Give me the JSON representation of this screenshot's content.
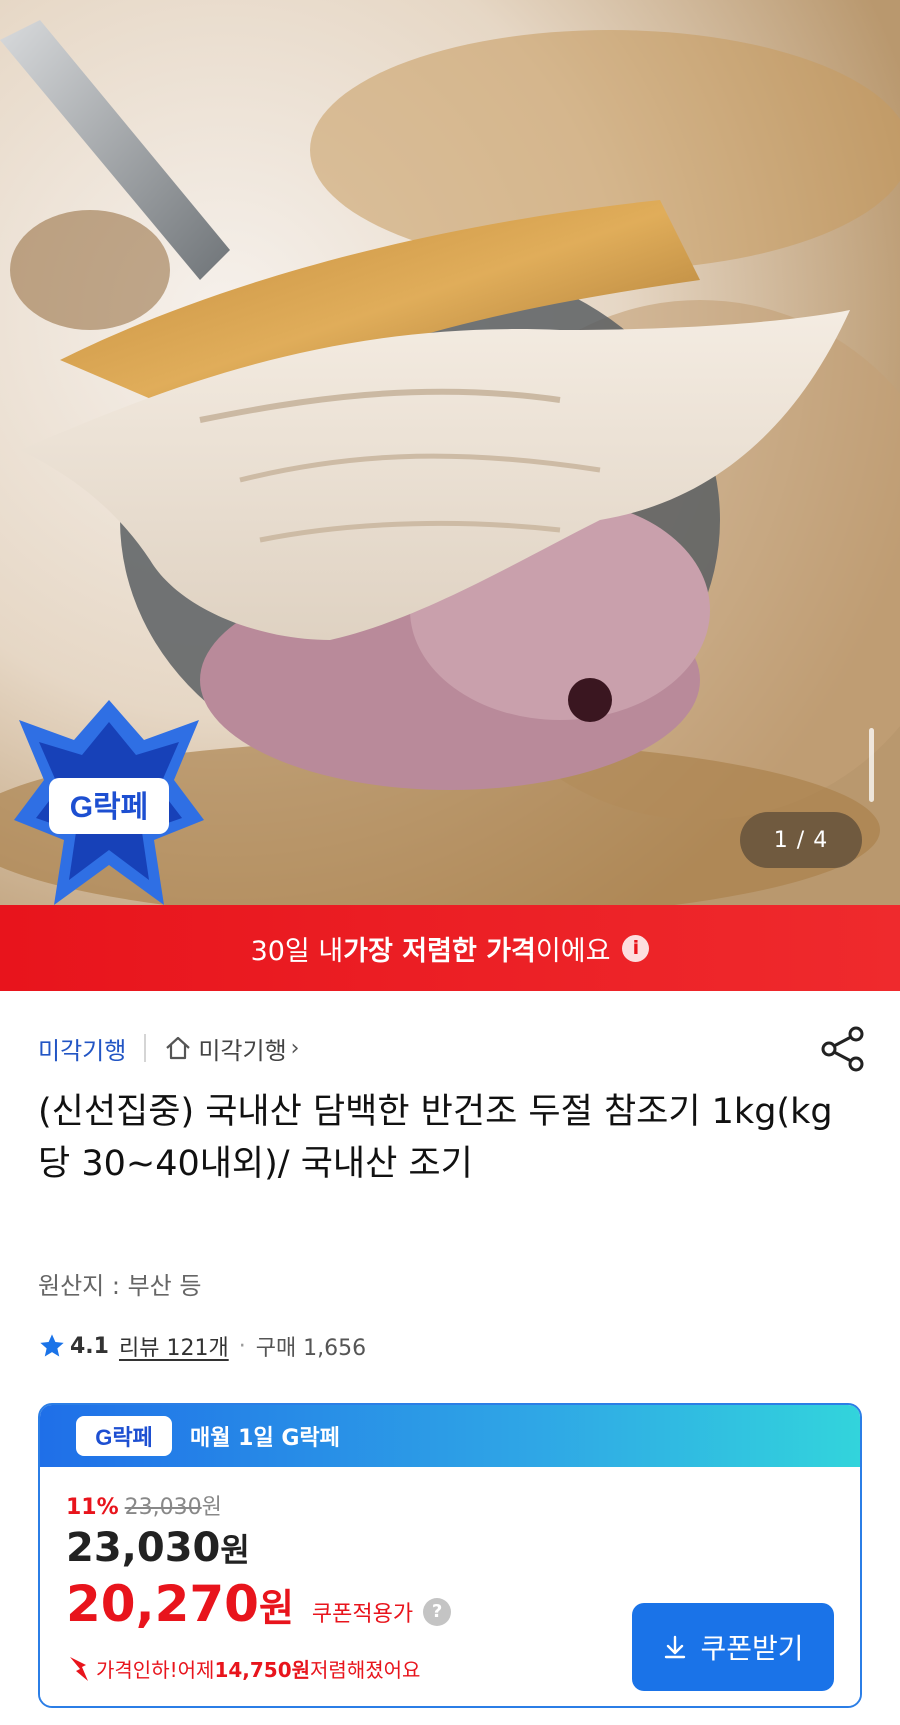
{
  "gallery": {
    "counter": "1 / 4"
  },
  "badge": {
    "text": "G락페"
  },
  "banner": {
    "prefix": "30일 내 ",
    "highlight": "가장 저렴한 가격",
    "suffix": "이에요",
    "info_icon": "info-icon"
  },
  "seller": {
    "name": "미각기행",
    "store_link": "미각기행",
    "chevron": "›"
  },
  "product": {
    "title": "(신선집중) 국내산 담백한 반건조 두절 참조기 1kg(kg당 30~40내외)/ 국내산 조기",
    "origin": "원산지 : 부산 등"
  },
  "rating": {
    "score": "4.1",
    "reviews": "리뷰 121개",
    "purchases": "구매 1,656"
  },
  "deal": {
    "badge": "G락페",
    "event": "매월 1일 G락페",
    "discount": "11%",
    "original_price": "23,030",
    "original_unit": "원",
    "price_number": "23,030",
    "price_unit": "원",
    "coupon_number": "20,270",
    "coupon_unit": "원",
    "coupon_label": "쿠폰적용가",
    "info_icon": "?",
    "drop_prefix": "가격인하! ",
    "drop_mid": "어제 ",
    "drop_amount": "14,750원",
    "drop_suffix": " 저렴해졌어요",
    "button_label": "쿠폰받기"
  },
  "colors": {
    "accent_red": "#e8141c",
    "accent_blue": "#1a73e8",
    "seller_blue": "#2255c4"
  }
}
